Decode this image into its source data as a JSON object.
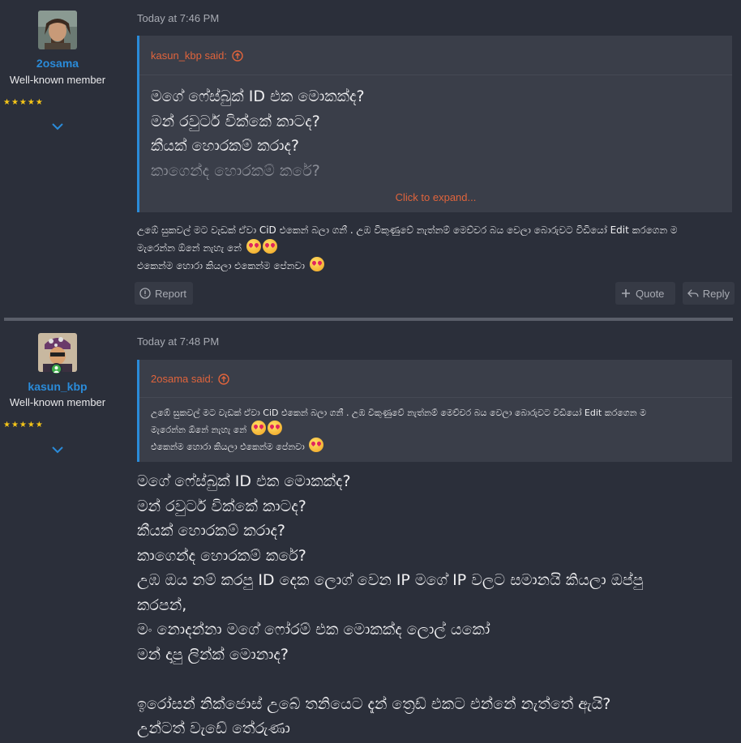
{
  "posts": [
    {
      "user": {
        "name": "2osama",
        "title": "Well-known member",
        "stars": "★★★★★"
      },
      "time": "Today at 7:46 PM",
      "quote": {
        "author": "kasun_kbp said:",
        "lines": [
          "මගේ ෆේස්බුක් ID එක මොකක්ද?",
          "මන් රවුටර් වික්කේ කාටද?",
          "කීයක් හොරකම් කරාද?",
          "කාගෙන්ද හොරකම් කරේ?"
        ],
        "expand": "Click to expand..."
      },
      "message": {
        "line1": "උඹේ සුකවල් මට වැඩක් ඒවා CiD එකෙන් බලා ගනී . උඹ විකුණුවේ නැත්නම් මෙච්චර බය වෙලා බොරුවට විඩියෝ Edit කරගෙන ම",
        "line2": "මැරෙන්න ඕනේ නැහැ නේ",
        "line3": "එකෙන්ම හොරා කියලා එකෙන්ම පේනවා"
      },
      "actions": {
        "report": "Report",
        "quote": "Quote",
        "reply": "Reply"
      }
    },
    {
      "user": {
        "name": "kasun_kbp",
        "title": "Well-known member",
        "stars": "★★★★★"
      },
      "time": "Today at 7:48 PM",
      "quote": {
        "author": "2osama said:",
        "line1": "උඹේ සුකවල් මට වැඩක් ඒවා CiD එකෙන් බලා ගනී . උඹ විකුණුවේ නැත්නම් මෙච්චර බය වෙලා බොරුවට විඩියෝ Edit කරගෙන ම",
        "line2": "මැරෙන්න ඕනේ නැහැ නේ",
        "line3": "එකෙන්ම හොරා කියලා එකෙන්ම පේනවා"
      },
      "message": {
        "lines": [
          "මගේ ෆේස්බුක් ID එක මොකක්ද?",
          "මන් රවුටර් වික්කේ කාටද?",
          "කීයක් හොරකම් කරාද?",
          "කාගෙන්ද හොරකම් කරේ?",
          "උඹ ඔය නම් කරපු ID දෙක ලොග් වෙන IP මගේ IP වලට සමානයි කියලා ඔප්පු",
          "කරපන්,",
          "මං නොදන්නා මගේ ෆෝරම් එක මොකක්ද ලොල් යකෝ",
          "මන් දාපු ලින්ක් මොනාද?",
          "",
          "ඉරෝසන් නික්ජොස් උබේ තනියෙට දැන් ත්‍රෙඩ් එකට එන්නේ නැත්තේ ඇයි?",
          "උන්ටත් වැඩේ තේරුණා"
        ]
      }
    }
  ],
  "colors": {
    "accent": "#2a8bd9",
    "quote_link": "#e0643c",
    "background": "#2b2f3a",
    "quote_bg": "#3a3e49",
    "star": "#f5c518",
    "online": "#3fae49"
  }
}
